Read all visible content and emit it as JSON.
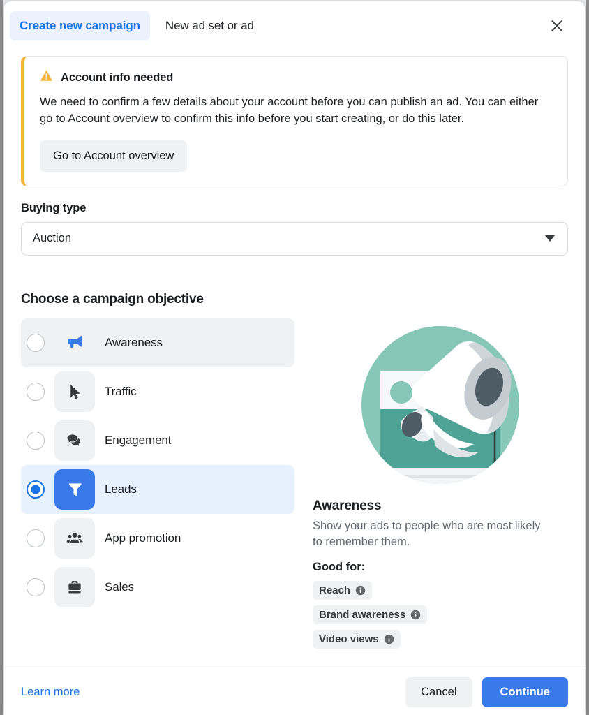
{
  "header": {
    "tab_active": "Create new campaign",
    "tab_inactive": "New ad set or ad",
    "close_icon": "close-icon"
  },
  "alert": {
    "icon": "warning-triangle-icon",
    "title": "Account info needed",
    "body": "We need to confirm a few details about your account before you can publish an ad. You can either go to Account overview to confirm this info before you start creating, or do this later.",
    "button_label": "Go to Account overview",
    "accent_color": "#f5b335"
  },
  "buying_type": {
    "label": "Buying type",
    "value": "Auction",
    "caret_icon": "chevron-down-icon"
  },
  "objectives": {
    "section_title": "Choose a campaign objective",
    "items": [
      {
        "label": "Awareness",
        "icon": "megaphone-icon",
        "state": "hover"
      },
      {
        "label": "Traffic",
        "icon": "cursor-icon",
        "state": "default"
      },
      {
        "label": "Engagement",
        "icon": "chat-bubbles-icon",
        "state": "default"
      },
      {
        "label": "Leads",
        "icon": "funnel-icon",
        "state": "selected"
      },
      {
        "label": "App promotion",
        "icon": "people-group-icon",
        "state": "default"
      },
      {
        "label": "Sales",
        "icon": "briefcase-icon",
        "state": "default"
      }
    ],
    "selected_index": 3
  },
  "detail": {
    "illustration": "megaphone-illustration",
    "title": "Awareness",
    "description": "Show your ads to people who are most likely to remember them.",
    "good_for_label": "Good for:",
    "chips": [
      {
        "label": "Reach",
        "icon": "info-icon"
      },
      {
        "label": "Brand awareness",
        "icon": "info-icon"
      },
      {
        "label": "Video views",
        "icon": "info-icon"
      }
    ]
  },
  "footer": {
    "learn_more": "Learn more",
    "cancel": "Cancel",
    "continue": "Continue"
  },
  "colors": {
    "accent_blue": "#1b74e4",
    "button_blue": "#3a79e8",
    "warning_amber": "#f5b335",
    "selected_row": "#e7f0fd",
    "tile_gray": "#eff1f3"
  }
}
